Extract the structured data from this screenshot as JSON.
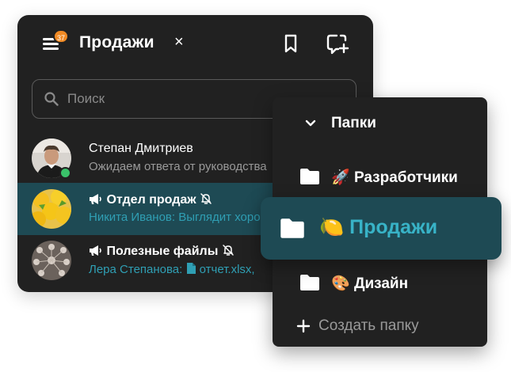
{
  "header": {
    "menu_badge": "37",
    "title": "Продажи",
    "close": "×"
  },
  "search": {
    "placeholder": "Поиск"
  },
  "chats": [
    {
      "name": "Степан Дмитриев",
      "preview": "Ожидаем ответа от руководства",
      "online": true
    },
    {
      "name": "Отдел продаж",
      "sender": "Никита Иванов:",
      "preview": "Выглядит хорошо",
      "muted": true,
      "active": true
    },
    {
      "name": "Полезные файлы",
      "sender": "Лера Степанова:",
      "preview": "отчет.xlsx,",
      "muted": true
    }
  ],
  "folders": {
    "header": "Папки",
    "items": [
      {
        "emoji": "🚀",
        "label": "Разработчики"
      },
      {
        "emoji": "🍋",
        "label": "Продажи",
        "selected": true
      },
      {
        "emoji": "🎨",
        "label": "Дизайн"
      }
    ],
    "create_label": "Создать папку"
  },
  "colors": {
    "panel": "#212121",
    "active_row": "#1e4a54",
    "accent": "#2f9fb4",
    "badge": "#f08a24",
    "online": "#3ac26a"
  }
}
